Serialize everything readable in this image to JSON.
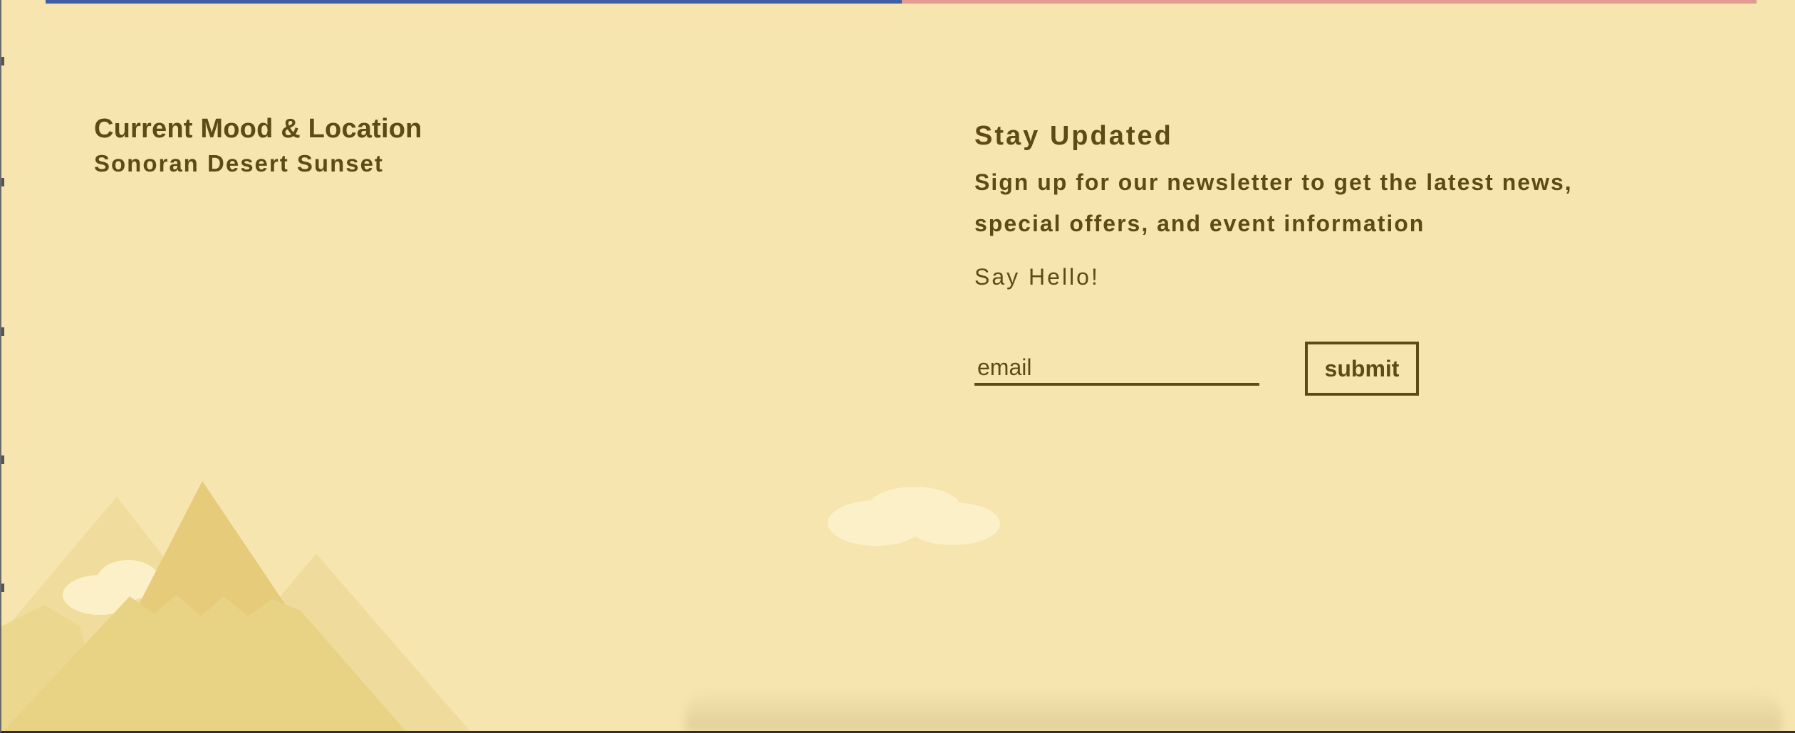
{
  "mood": {
    "title": "Current Mood & Location",
    "subtitle": "Sonoran Desert Sunset"
  },
  "newsletter": {
    "title": "Stay Updated",
    "description_line1": "Sign up for our newsletter to get the latest news,",
    "description_line2": "special offers, and event information",
    "hello": "Say Hello!",
    "email_placeholder": "email",
    "submit_label": "submit"
  },
  "colors": {
    "background": "#f7e5b0",
    "text": "#5e4a16",
    "topbar_left": "#3e5fa6",
    "topbar_right": "#e39a91",
    "mountain_light": "#f0dc9c",
    "mountain_mid": "#e6cc7c",
    "mountain_front": "#e8d284",
    "cloud": "#fbf0c8"
  },
  "icons": {
    "mountains": "mountains-illustration",
    "cloud": "cloud-icon"
  }
}
